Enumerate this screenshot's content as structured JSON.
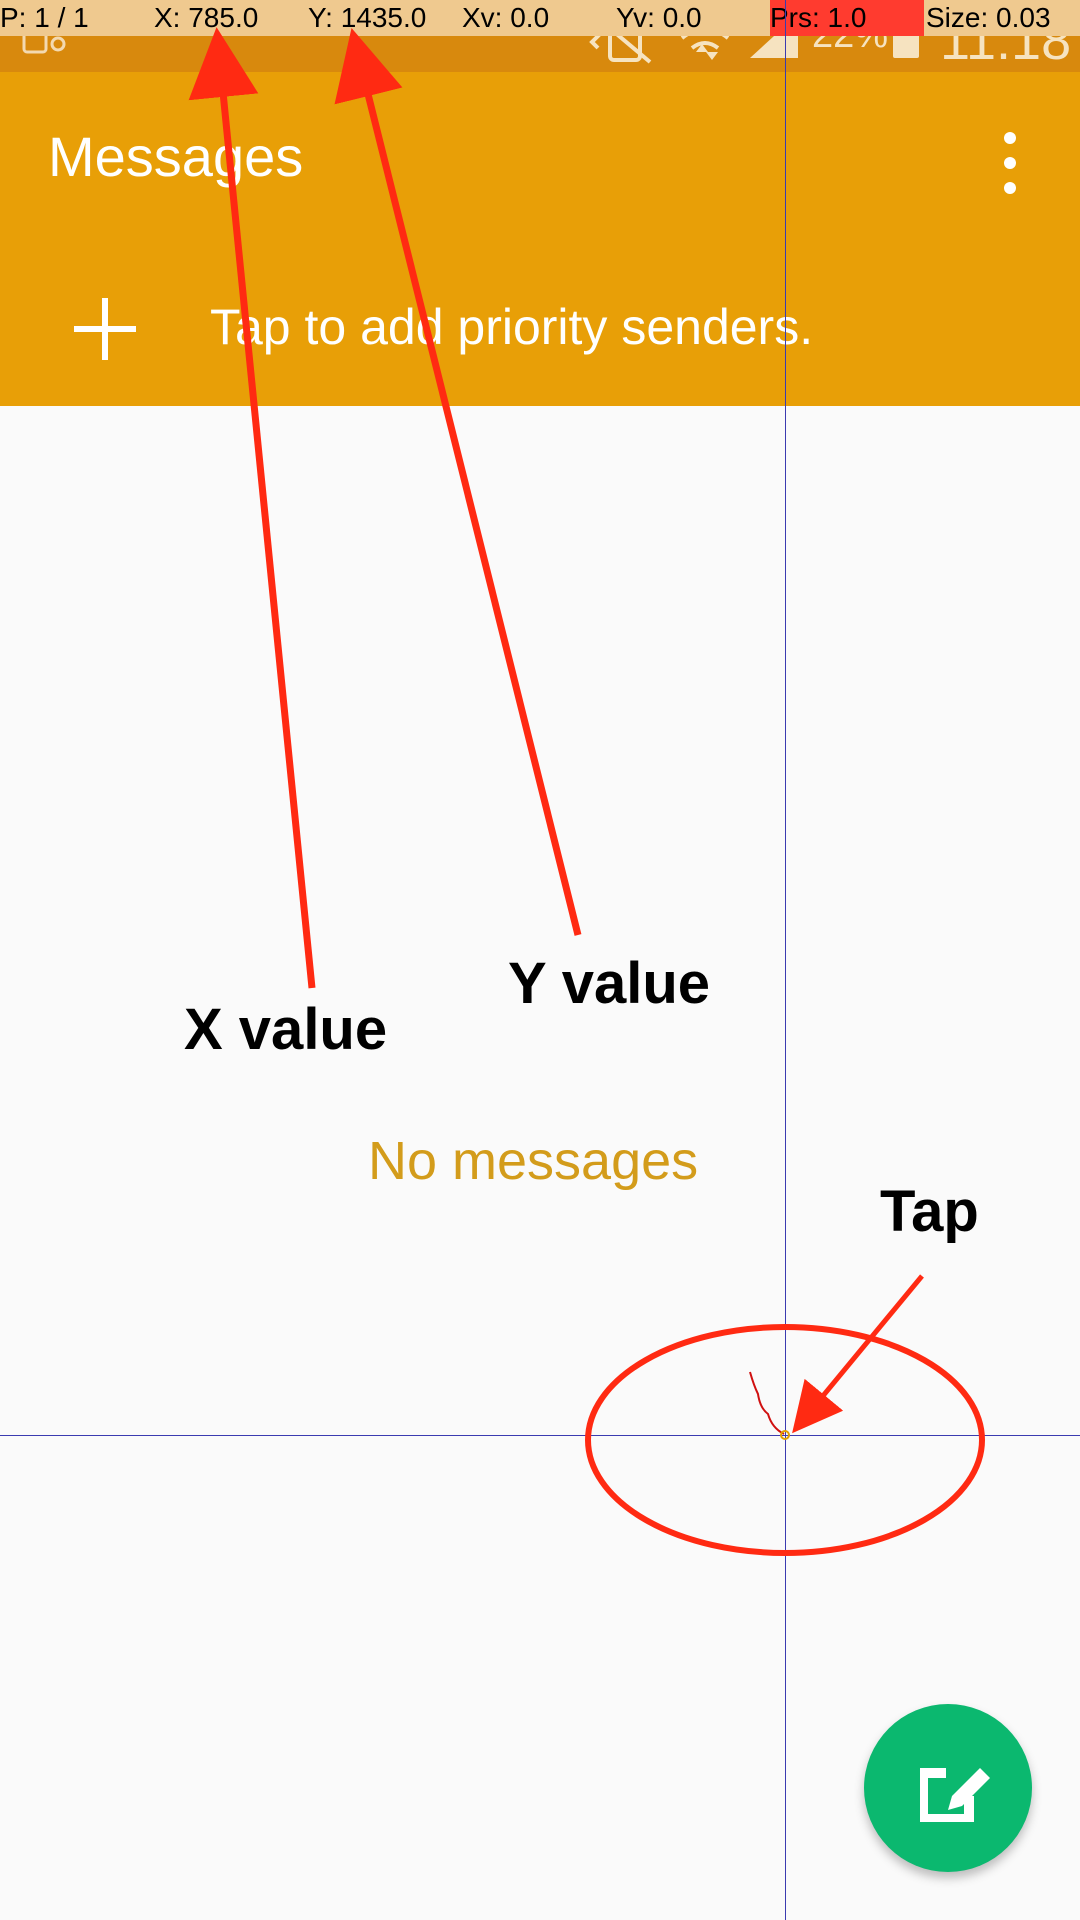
{
  "overlay": {
    "pointers": "P: 1 / 1",
    "x": "X: 785.0",
    "y": "Y: 1435.0",
    "xv": "Xv: 0.0",
    "yv": "Yv: 0.0",
    "pressure": "Prs: 1.0",
    "size": "Size: 0.03"
  },
  "statusbar": {
    "battery": "22%",
    "time": "11:18"
  },
  "appbar": {
    "title": "Messages",
    "priority_text": "Tap to add priority senders."
  },
  "content": {
    "empty_text": "No messages"
  },
  "annotations": {
    "x_label": "X value",
    "y_label": "Y value",
    "tap_label": "Tap"
  },
  "colors": {
    "appbar": "#e89f07",
    "statusbar": "#d8890d",
    "fab": "#0bb86f",
    "annotation_red": "#ff2a12"
  },
  "icons": [
    "notification-icon",
    "vibrate-icon",
    "wifi-icon",
    "data-icon",
    "signal-icon",
    "battery-icon",
    "more-vert-icon",
    "plus-icon",
    "compose-icon"
  ]
}
